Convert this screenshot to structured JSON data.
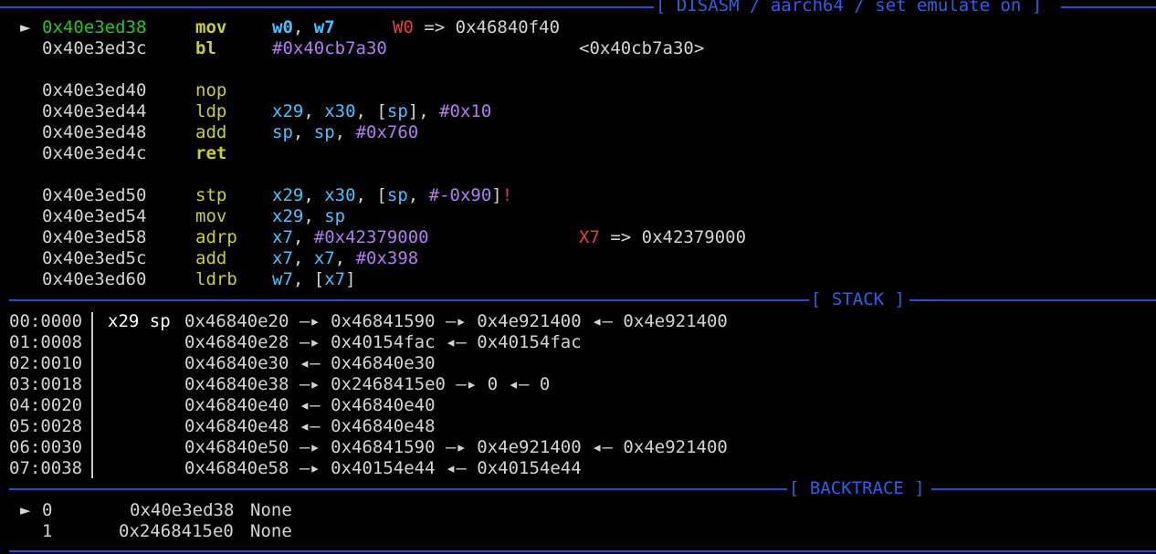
{
  "disasm": {
    "title": "[ DISASM / aarch64 / set emulate on ]",
    "lines": [
      {
        "marker": "►",
        "addr": "0x40e3ed38",
        "mnem": "mov",
        "ops": [
          [
            "w0",
            "reg-b"
          ],
          [
            ", ",
            "punct"
          ],
          [
            "w7",
            "reg-b"
          ]
        ],
        "ann_reg": "W0",
        "ann_text": " => 0x46840f40",
        "current": true,
        "mnem_bold": true
      },
      {
        "marker": "",
        "addr": "0x40e3ed3c",
        "mnem": "bl",
        "ops": [
          [
            "#0x40cb7a30",
            "imm"
          ]
        ],
        "ann_reg": "",
        "ann_text": "<0x40cb7a30>",
        "current": false,
        "mnem_bold": true
      },
      {
        "marker": "",
        "addr": "",
        "mnem": "",
        "ops": [],
        "ann_reg": "",
        "ann_text": "",
        "current": false,
        "mnem_bold": false
      },
      {
        "marker": "",
        "addr": "0x40e3ed40",
        "mnem": "nop",
        "ops": [],
        "ann_reg": "",
        "ann_text": "",
        "current": false,
        "mnem_bold": false
      },
      {
        "marker": "",
        "addr": "0x40e3ed44",
        "mnem": "ldp",
        "ops": [
          [
            "x29",
            "reg"
          ],
          [
            ", ",
            "punct"
          ],
          [
            "x30",
            "reg"
          ],
          [
            ", [",
            "punct"
          ],
          [
            "sp",
            "reg"
          ],
          [
            "], ",
            "punct"
          ],
          [
            "#0x10",
            "imm"
          ]
        ],
        "ann_reg": "",
        "ann_text": "",
        "current": false,
        "mnem_bold": false
      },
      {
        "marker": "",
        "addr": "0x40e3ed48",
        "mnem": "add",
        "ops": [
          [
            "sp",
            "reg"
          ],
          [
            ", ",
            "punct"
          ],
          [
            "sp",
            "reg"
          ],
          [
            ", ",
            "punct"
          ],
          [
            "#0x760",
            "imm"
          ]
        ],
        "ann_reg": "",
        "ann_text": "",
        "current": false,
        "mnem_bold": false
      },
      {
        "marker": "",
        "addr": "0x40e3ed4c",
        "mnem": "ret",
        "ops": [],
        "ann_reg": "",
        "ann_text": "",
        "current": false,
        "mnem_bold": true
      },
      {
        "marker": "",
        "addr": "",
        "mnem": "",
        "ops": [],
        "ann_reg": "",
        "ann_text": "",
        "current": false,
        "mnem_bold": false
      },
      {
        "marker": "",
        "addr": "0x40e3ed50",
        "mnem": "stp",
        "ops": [
          [
            "x29",
            "reg"
          ],
          [
            ", ",
            "punct"
          ],
          [
            "x30",
            "reg"
          ],
          [
            ", [",
            "punct"
          ],
          [
            "sp",
            "reg"
          ],
          [
            ", ",
            "punct"
          ],
          [
            "#-0x90",
            "imm"
          ],
          [
            "]",
            "punct"
          ],
          [
            "!",
            "bang"
          ]
        ],
        "ann_reg": "",
        "ann_text": "",
        "current": false,
        "mnem_bold": false
      },
      {
        "marker": "",
        "addr": "0x40e3ed54",
        "mnem": "mov",
        "ops": [
          [
            "x29",
            "reg"
          ],
          [
            ", ",
            "punct"
          ],
          [
            "sp",
            "reg"
          ]
        ],
        "ann_reg": "",
        "ann_text": "",
        "current": false,
        "mnem_bold": false
      },
      {
        "marker": "",
        "addr": "0x40e3ed58",
        "mnem": "adrp",
        "ops": [
          [
            "x7",
            "reg"
          ],
          [
            ", ",
            "punct"
          ],
          [
            "#0x42379000",
            "imm"
          ]
        ],
        "ann_reg": "X7",
        "ann_text": " => 0x42379000",
        "current": false,
        "mnem_bold": false
      },
      {
        "marker": "",
        "addr": "0x40e3ed5c",
        "mnem": "add",
        "ops": [
          [
            "x7",
            "reg"
          ],
          [
            ", ",
            "punct"
          ],
          [
            "x7",
            "reg"
          ],
          [
            ", ",
            "punct"
          ],
          [
            "#0x398",
            "imm"
          ]
        ],
        "ann_reg": "",
        "ann_text": "",
        "current": false,
        "mnem_bold": false
      },
      {
        "marker": "",
        "addr": "0x40e3ed60",
        "mnem": "ldrb",
        "ops": [
          [
            "w7",
            "reg"
          ],
          [
            ", [",
            "punct"
          ],
          [
            "x7",
            "reg"
          ],
          [
            "]",
            "punct"
          ]
        ],
        "ann_reg": "",
        "ann_text": "",
        "current": false,
        "mnem_bold": false
      }
    ]
  },
  "stack": {
    "title": "[ STACK ]",
    "rows": [
      {
        "offset": "00:0000",
        "regs": "x29 sp",
        "chain": "0x46840e20 —▸ 0x46841590 —▸ 0x4e921400 ◂— 0x4e921400"
      },
      {
        "offset": "01:0008",
        "regs": "",
        "chain": "0x46840e28 —▸ 0x40154fac ◂— 0x40154fac"
      },
      {
        "offset": "02:0010",
        "regs": "",
        "chain": "0x46840e30 ◂— 0x46840e30"
      },
      {
        "offset": "03:0018",
        "regs": "",
        "chain": "0x46840e38 —▸ 0x2468415e0 —▸ 0 ◂— 0"
      },
      {
        "offset": "04:0020",
        "regs": "",
        "chain": "0x46840e40 ◂— 0x46840e40"
      },
      {
        "offset": "05:0028",
        "regs": "",
        "chain": "0x46840e48 ◂— 0x46840e48"
      },
      {
        "offset": "06:0030",
        "regs": "",
        "chain": "0x46840e50 —▸ 0x46841590 —▸ 0x4e921400 ◂— 0x4e921400"
      },
      {
        "offset": "07:0038",
        "regs": "",
        "chain": "0x46840e58 —▸ 0x40154e44 ◂— 0x40154e44"
      }
    ]
  },
  "backtrace": {
    "title": "[ BACKTRACE ]",
    "frames": [
      {
        "marker": "►",
        "index": "0",
        "addr": "0x40e3ed38",
        "symbol": "None"
      },
      {
        "marker": "",
        "index": "1",
        "addr": "0x2468415e0",
        "symbol": "None"
      }
    ]
  },
  "colors": {
    "background": "#000000",
    "separator": "#1f4fd6",
    "current_addr": "#26c426",
    "mnemonic": "#c8d030",
    "register": "#4ac0ff",
    "immediate": "#b07cf0",
    "annotation_register": "#e24040",
    "writeback": "#e0306e"
  }
}
